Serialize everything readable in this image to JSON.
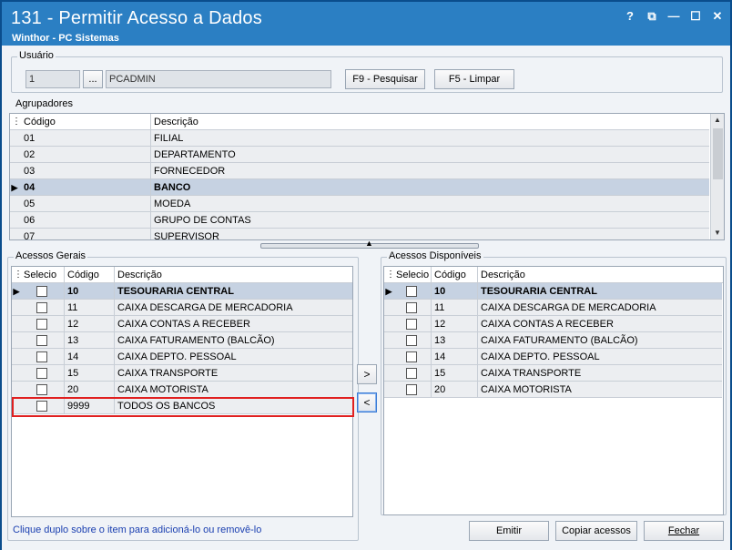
{
  "window": {
    "title": "131 - Permitir Acesso a Dados",
    "subtitle": "Winthor - PC Sistemas",
    "controls": {
      "help": "?",
      "restore": "⧉",
      "minimize": "—",
      "maximize": "☐",
      "close": "✕"
    }
  },
  "usuario": {
    "label": "Usuário",
    "code": "1",
    "browse": "...",
    "name": "PCADMIN",
    "search_button": "F9 - Pesquisar",
    "clear_button": "F5 - Limpar"
  },
  "agrupadores": {
    "label": "Agrupadores",
    "columns": [
      "Código",
      "Descrição"
    ],
    "rows": [
      {
        "code": "01",
        "desc": "FILIAL"
      },
      {
        "code": "02",
        "desc": "DEPARTAMENTO"
      },
      {
        "code": "03",
        "desc": "FORNECEDOR"
      },
      {
        "code": "04",
        "desc": "BANCO"
      },
      {
        "code": "05",
        "desc": "MOEDA"
      },
      {
        "code": "06",
        "desc": "GRUPO DE CONTAS"
      },
      {
        "code": "07",
        "desc": "SUPERVISOR"
      }
    ],
    "selected_index": 3
  },
  "acessos_gerais": {
    "label": "Acessos Gerais",
    "columns": [
      "Selecio",
      "Código",
      "Descrição"
    ],
    "rows": [
      {
        "code": "10",
        "desc": "TESOURARIA CENTRAL"
      },
      {
        "code": "11",
        "desc": "CAIXA DESCARGA DE MERCADORIA"
      },
      {
        "code": "12",
        "desc": "CAIXA CONTAS A RECEBER"
      },
      {
        "code": "13",
        "desc": "CAIXA FATURAMENTO (BALCÃO)"
      },
      {
        "code": "14",
        "desc": "CAIXA DEPTO. PESSOAL"
      },
      {
        "code": "15",
        "desc": "CAIXA TRANSPORTE"
      },
      {
        "code": "20",
        "desc": "CAIXA MOTORISTA"
      },
      {
        "code": "9999",
        "desc": "TODOS OS BANCOS"
      }
    ],
    "selected_index": 0
  },
  "acessos_disponiveis": {
    "label": "Acessos Disponíveis",
    "columns": [
      "Selecio",
      "Código",
      "Descrição"
    ],
    "rows": [
      {
        "code": "10",
        "desc": "TESOURARIA CENTRAL"
      },
      {
        "code": "11",
        "desc": "CAIXA DESCARGA DE MERCADORIA"
      },
      {
        "code": "12",
        "desc": "CAIXA CONTAS A RECEBER"
      },
      {
        "code": "13",
        "desc": "CAIXA FATURAMENTO (BALCÃO)"
      },
      {
        "code": "14",
        "desc": "CAIXA DEPTO. PESSOAL"
      },
      {
        "code": "15",
        "desc": "CAIXA TRANSPORTE"
      },
      {
        "code": "20",
        "desc": "CAIXA MOTORISTA"
      }
    ],
    "selected_index": 0
  },
  "move": {
    "add": ">",
    "remove": "<"
  },
  "footer": {
    "hint": "Clique duplo sobre o item para adicioná-lo ou removê-lo",
    "emitir": "Emitir",
    "copiar": "Copiar acessos",
    "fechar": "Fechar"
  }
}
